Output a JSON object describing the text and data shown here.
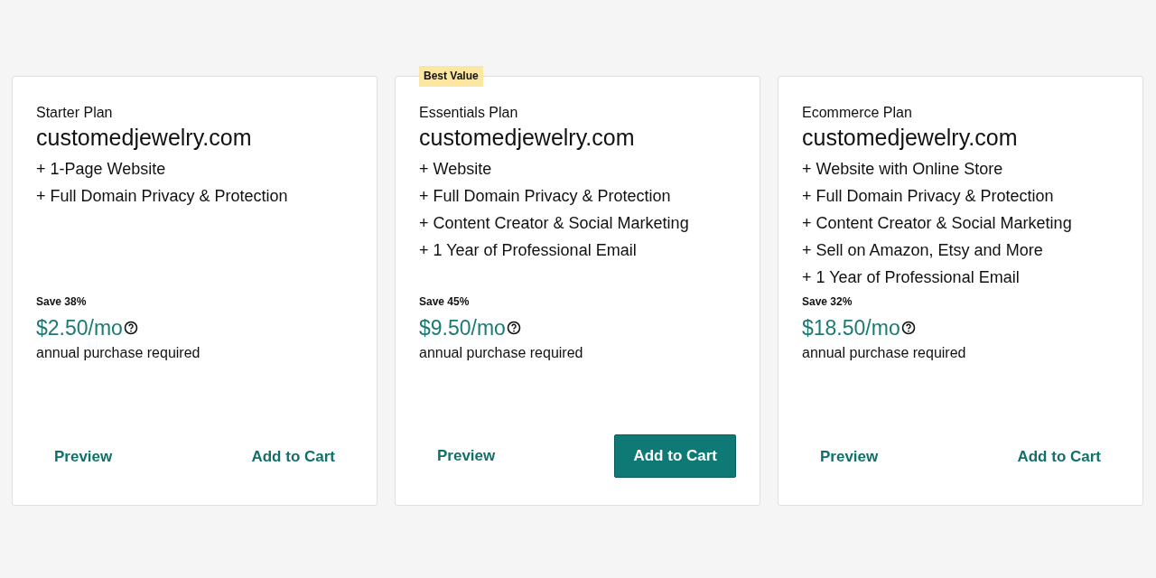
{
  "plans": [
    {
      "name": "Starter Plan",
      "domain": "customedjewelry.com",
      "features": [
        "+ 1-Page Website",
        "+ Full Domain Privacy & Protection"
      ],
      "save": "Save 38%",
      "price": "$2.50/mo",
      "note": "annual purchase required",
      "preview": "Preview",
      "cart": "Add to Cart",
      "featured": false
    },
    {
      "badge": "Best Value",
      "name": "Essentials Plan",
      "domain": "customedjewelry.com",
      "features": [
        "+ Website",
        "+ Full Domain Privacy & Protection",
        "+ Content Creator & Social Marketing",
        "+ 1 Year of Professional Email"
      ],
      "save": "Save 45%",
      "price": "$9.50/mo",
      "note": "annual purchase required",
      "preview": "Preview",
      "cart": "Add to Cart",
      "featured": true
    },
    {
      "name": "Ecommerce Plan",
      "domain": "customedjewelry.com",
      "features": [
        "+ Website with Online Store",
        "+ Full Domain Privacy & Protection",
        "+ Content Creator & Social Marketing",
        "+ Sell on Amazon, Etsy and More",
        "+ 1 Year of Professional Email"
      ],
      "save": "Save 32%",
      "price": "$18.50/mo",
      "note": "annual purchase required",
      "preview": "Preview",
      "cart": "Add to Cart",
      "featured": false
    }
  ]
}
